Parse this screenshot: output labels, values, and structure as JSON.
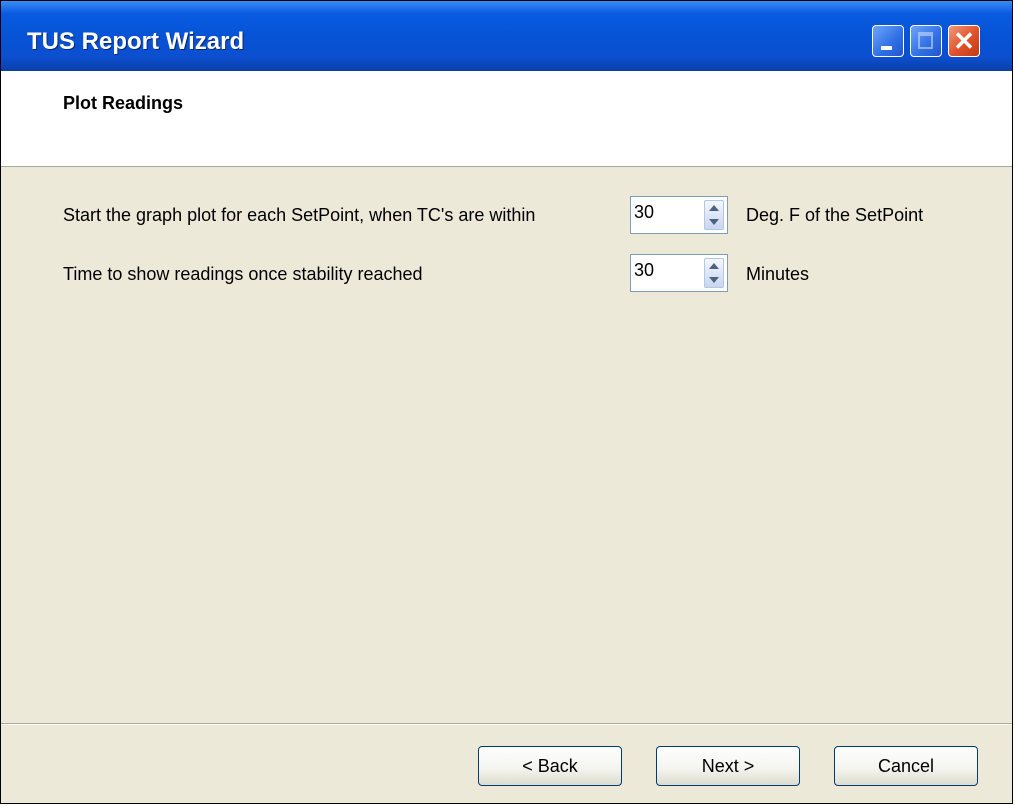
{
  "window": {
    "title": "TUS Report Wizard"
  },
  "header": {
    "title": "Plot Readings"
  },
  "settings": {
    "stability": {
      "label": "Start the graph plot for each SetPoint, when TC's are within",
      "value": "30",
      "unit": "Deg. F of the SetPoint"
    },
    "duration": {
      "label": "Time to show readings once stability reached",
      "value": "30",
      "unit": "Minutes"
    }
  },
  "buttons": {
    "back": "< Back",
    "next": "Next >",
    "cancel": "Cancel"
  },
  "colors": {
    "titlebar": "#0653d6",
    "dialog_bg": "#ece9d8",
    "header_bg": "#ffffff",
    "close_button": "#e0502a"
  }
}
